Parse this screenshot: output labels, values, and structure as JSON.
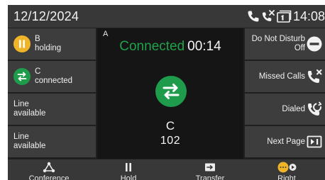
{
  "status_bar": {
    "date": "12/12/2024",
    "time": "14:08",
    "icons": [
      "phone-icon",
      "missed-call-icon",
      "message-waiting-icon"
    ]
  },
  "line_keys": [
    {
      "title": "B",
      "status": "holding",
      "icon": "pause-icon",
      "icon_color": "#f0b429"
    },
    {
      "title": "C",
      "status": "connected",
      "icon": "transfer-arrows-icon",
      "icon_color": "#1e9c4b"
    },
    {
      "title": "Line",
      "status": "available"
    },
    {
      "title": "Line",
      "status": "available"
    }
  ],
  "call": {
    "line": "A",
    "status": "Connected",
    "duration": "00:14",
    "party_name": "C",
    "party_number": "102",
    "icon": "transfer-arrows-icon",
    "status_color": "#1fa34a"
  },
  "soft_keys": [
    {
      "label_line1": "Do Not Disturb",
      "label_line2": "Off",
      "icon": "do-not-disturb-icon"
    },
    {
      "label_line1": "Missed Calls",
      "icon": "missed-calls-icon"
    },
    {
      "label_line1": "Dialed",
      "icon": "dialed-calls-icon"
    },
    {
      "label_line1": "Next Page",
      "icon": "next-page-icon"
    }
  ],
  "bottom_keys": [
    {
      "label": "Conference",
      "icon": "conference-icon"
    },
    {
      "label": "Hold",
      "icon": "pause-icon"
    },
    {
      "label": "Transfer",
      "icon": "transfer-icon"
    },
    {
      "label": "Right",
      "icon": "right-dots-icon"
    }
  ]
}
